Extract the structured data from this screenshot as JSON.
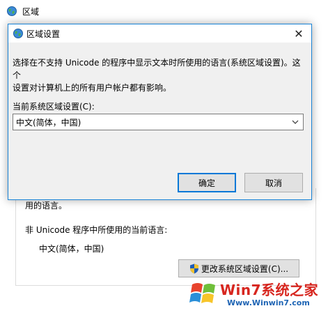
{
  "background_window": {
    "title": "区域",
    "partial_text": "用的语言。",
    "nonunicode_label": "非 Unicode 程序中所使用的当前语言:",
    "nonunicode_value": "中文(简体，中国)",
    "change_button_label": "更改系统区域设置(C)..."
  },
  "dialog": {
    "title": "区域设置",
    "description_line1": "选择在不支持 Unicode 的程序中显示文本时所使用的语言(系统区域设置)。这个",
    "description_line2": "设置对计算机上的所有用户帐户都有影响。",
    "current_locale_label": "当前系统区域设置(C):",
    "current_locale_value": "中文(简体，中国)",
    "ok_label": "确定",
    "cancel_label": "取消",
    "close_glyph": "✕"
  },
  "watermark": {
    "brand": "Win7系统之家",
    "url": "Www.Winwin7.com"
  },
  "colors": {
    "accent_blue": "#0078d7",
    "dialog_border": "#1883d7",
    "dialog_bg": "#f0f0f0",
    "button_bg": "#e1e1e1",
    "watermark_red": "#d7261f",
    "watermark_blue": "#1d64b4"
  }
}
